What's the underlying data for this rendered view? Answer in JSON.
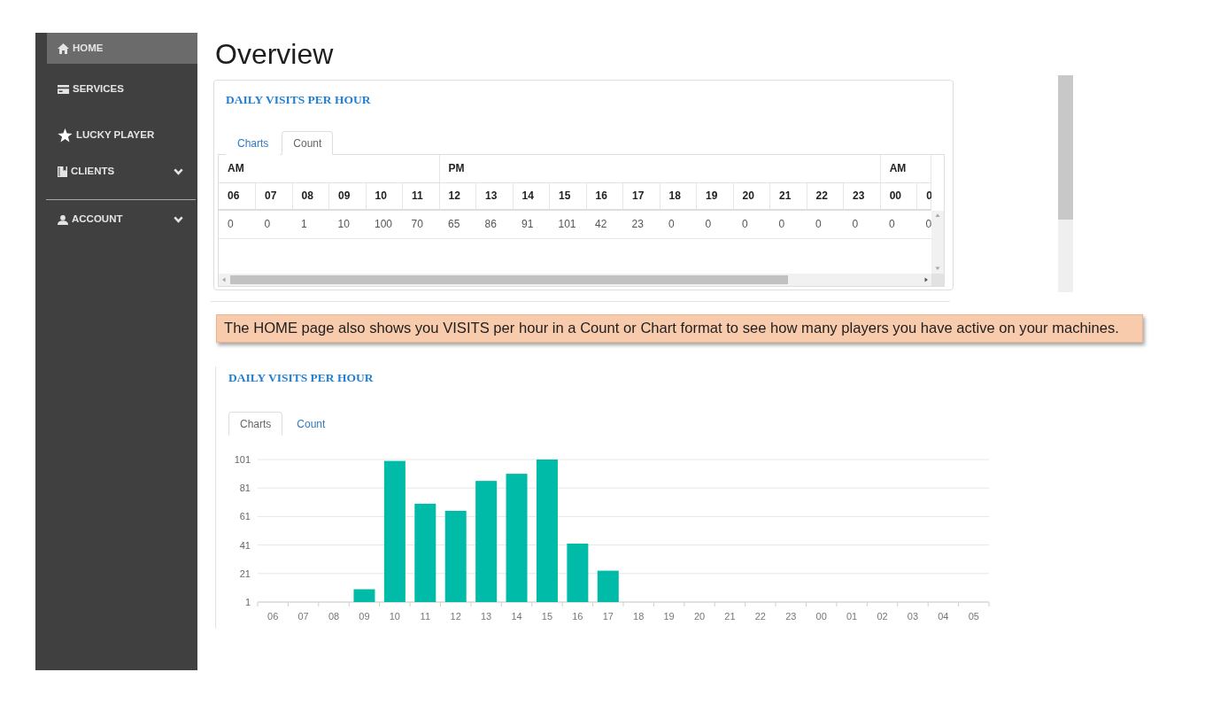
{
  "sidebar": {
    "sections": [
      {
        "items": [
          {
            "label": "HOME",
            "kind": "link",
            "selected": true
          },
          {
            "label": "SERVICES",
            "kind": "link",
            "selected": false
          },
          {
            "label": "LUCKY PLAYER",
            "kind": "link",
            "selected": false
          },
          {
            "label": "CLIENTS",
            "kind": "group",
            "selected": false
          }
        ]
      },
      {
        "items": [
          {
            "label": "ACCOUNT",
            "kind": "group",
            "selected": false
          }
        ]
      }
    ]
  },
  "page_title": "Overview",
  "count_panel": {
    "title": "DAILY VISITS PER HOUR",
    "tabs": [
      {
        "label": "Charts",
        "selected": false
      },
      {
        "label": "Count",
        "selected": true
      }
    ],
    "table": {
      "column_groups": [
        {
          "period": "AM",
          "hours": [
            "06",
            "07",
            "08",
            "09",
            "10",
            "11"
          ]
        },
        {
          "period": "PM",
          "hours": [
            "12",
            "13",
            "14",
            "15",
            "16",
            "17",
            "18",
            "19",
            "20",
            "21",
            "22",
            "23"
          ]
        },
        {
          "period": "AM",
          "hours": [
            "00",
            "0"
          ]
        }
      ],
      "rows": [
        [
          "0",
          "0",
          "1",
          "10",
          "100",
          "70",
          "65",
          "86",
          "91",
          "101",
          "42",
          "23",
          "0",
          "0",
          "0",
          "0",
          "0",
          "0",
          "0",
          "0"
        ]
      ]
    }
  },
  "note": "The HOME page also shows you VISITS per hour in a Count or Chart format to see how many players you have active on your machines.",
  "chart_panel": {
    "title": "DAILY VISITS PER HOUR",
    "tabs": [
      {
        "label": "Charts",
        "selected": true
      },
      {
        "label": "Count",
        "selected": false
      }
    ],
    "chart_data": {
      "type": "bar",
      "categories": [
        "06",
        "07",
        "08",
        "09",
        "10",
        "11",
        "12",
        "13",
        "14",
        "15",
        "16",
        "17",
        "18",
        "19",
        "20",
        "21",
        "22",
        "23",
        "00",
        "01",
        "02",
        "03",
        "04",
        "05"
      ],
      "values": [
        null,
        null,
        1,
        10,
        100,
        70,
        65,
        86,
        91,
        101,
        42,
        23,
        null,
        null,
        null,
        null,
        null,
        null,
        null,
        null,
        null,
        null,
        null,
        null
      ],
      "ylim": [
        1,
        101
      ],
      "yticks": [
        1,
        21,
        41,
        61,
        81,
        101
      ],
      "grid": true
    }
  }
}
